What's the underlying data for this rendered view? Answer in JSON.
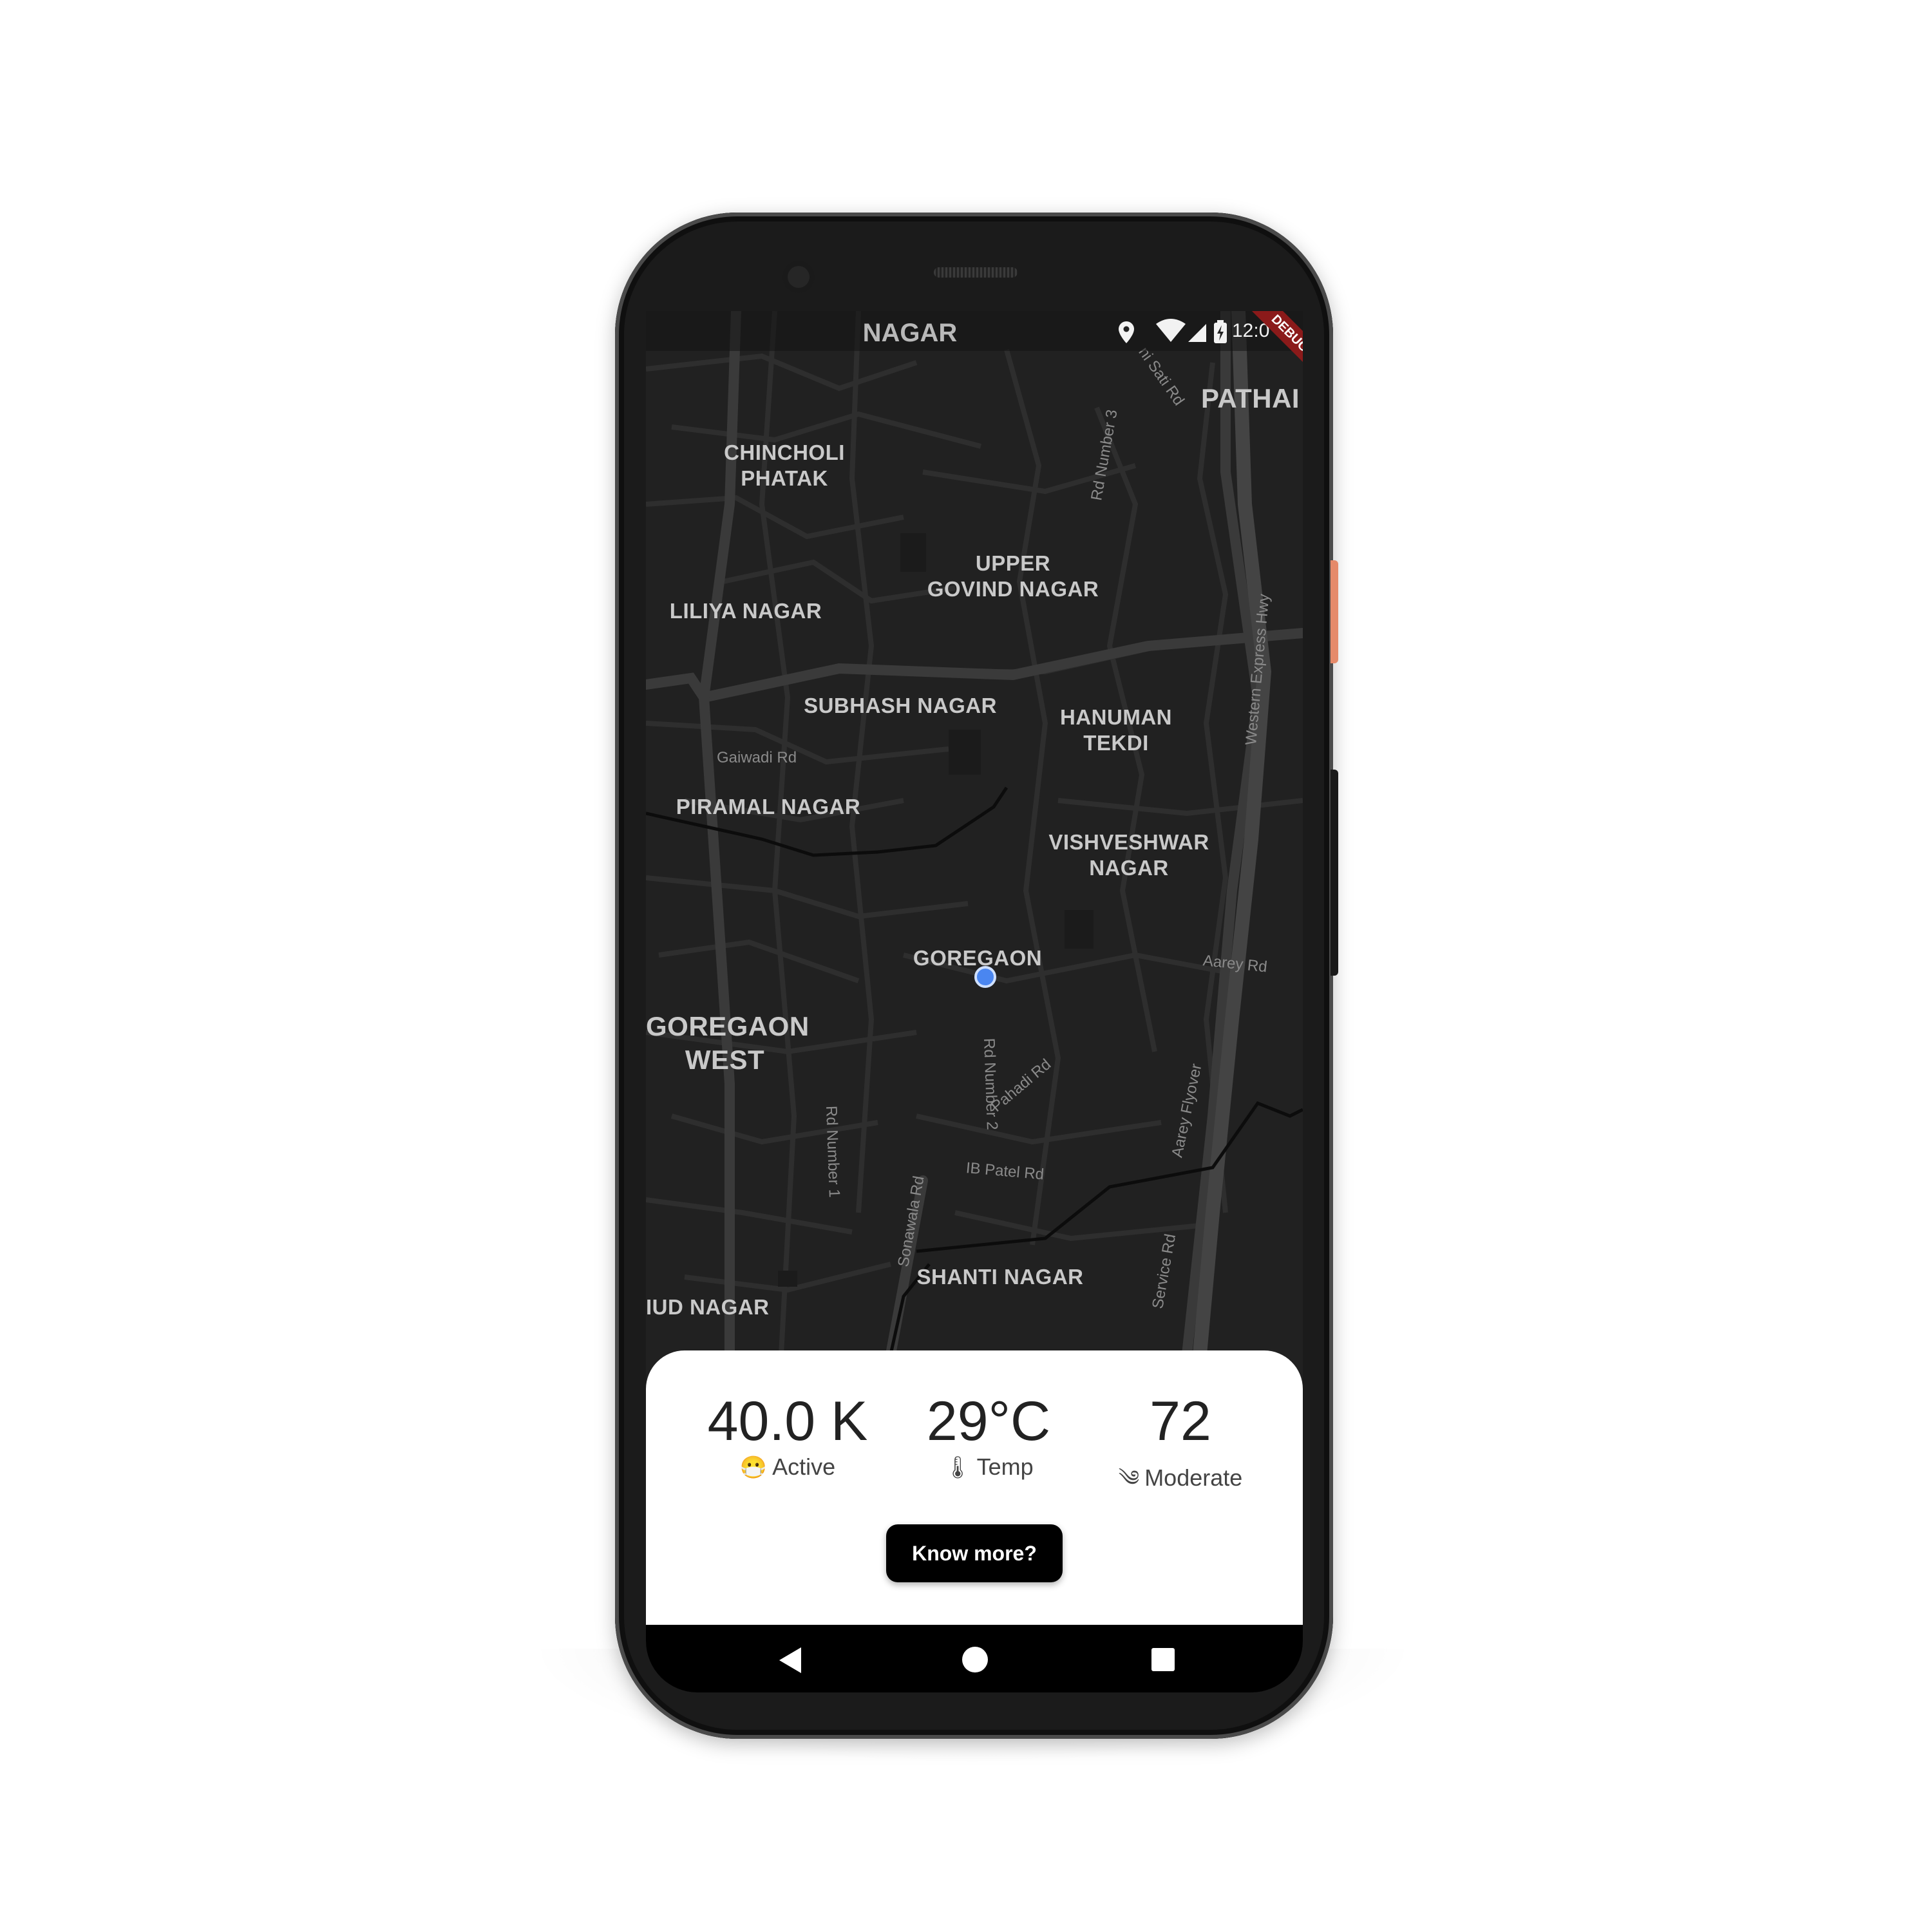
{
  "status_bar": {
    "title": "NAGAR",
    "time": "12:0",
    "debug_badge": "DEBUG",
    "icons": [
      "location-icon",
      "wifi-icon",
      "signal-icon",
      "battery-icon"
    ]
  },
  "map": {
    "areas": [
      {
        "name": "CHINCHOLI\nPHATAK"
      },
      {
        "name": "UPPER\nGOVIND NAGAR"
      },
      {
        "name": "LILIYA NAGAR"
      },
      {
        "name": "SUBHASH NAGAR"
      },
      {
        "name": "HANUMAN\nTEKDI"
      },
      {
        "name": "PIRAMAL NAGAR"
      },
      {
        "name": "VISHVESHWAR\nNAGAR"
      },
      {
        "name": "GOREGAON"
      },
      {
        "name": "GOREGAON\nWEST"
      },
      {
        "name": "SHANTI NAGAR"
      },
      {
        "name": "IUD NAGAR"
      },
      {
        "name": "PATHAI"
      }
    ],
    "roads": [
      {
        "name": "Rd Number 3"
      },
      {
        "name": "Western Express Hwy"
      },
      {
        "name": "Gaiwadi Rd"
      },
      {
        "name": "Aarey Rd"
      },
      {
        "name": "Rd Number 2"
      },
      {
        "name": "Pahadi Rd"
      },
      {
        "name": "Rd Number 1"
      },
      {
        "name": "IB Patel Rd"
      },
      {
        "name": "Sonawala Rd"
      },
      {
        "name": "Aarey Flyover"
      },
      {
        "name": "Service Rd"
      },
      {
        "name": "ni Sati Rd"
      }
    ],
    "colors": {
      "background": "#212121",
      "roads": "#3a3a3a",
      "labels": "#c9c9c9"
    }
  },
  "stats": [
    {
      "value": "40.0 K",
      "caption": "Active",
      "icon": "mask-face-icon",
      "glyph": "😷"
    },
    {
      "value": "29°C",
      "caption": "Temp",
      "icon": "thermometer-icon",
      "glyph": "🌡"
    },
    {
      "value": "72",
      "caption": "Moderate",
      "icon": "wind-icon",
      "glyph": "༄"
    }
  ],
  "actions": {
    "know_more": "Know more?"
  },
  "nav": [
    "back-icon",
    "home-icon",
    "recents-icon"
  ]
}
